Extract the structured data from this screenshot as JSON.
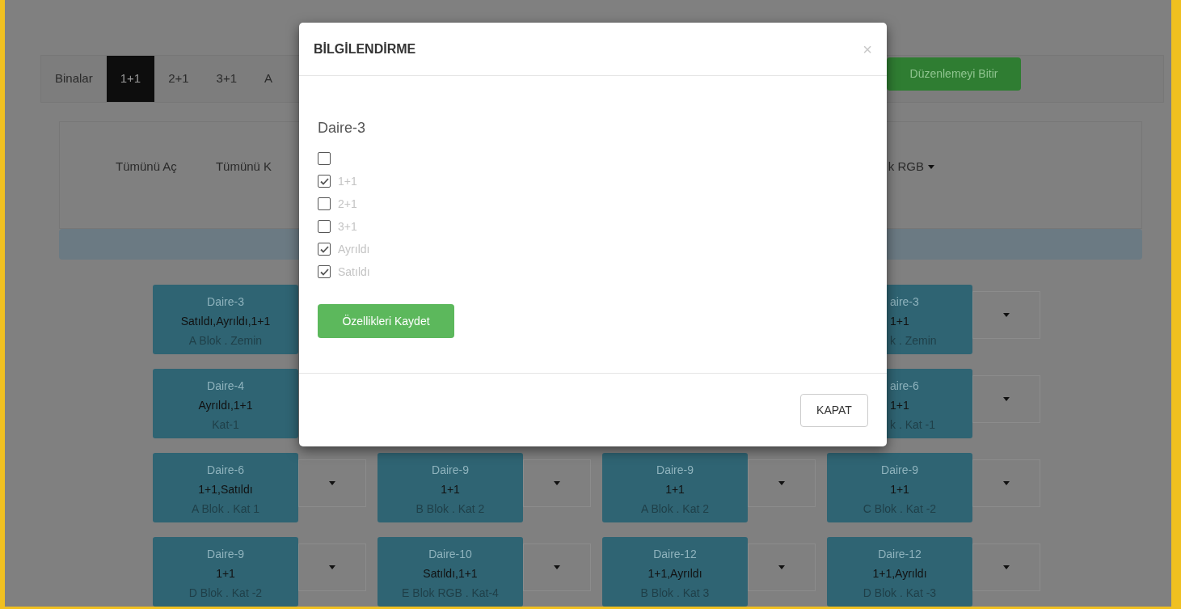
{
  "nav": {
    "items": [
      {
        "label": "Binalar",
        "selected": false
      },
      {
        "label": "1+1",
        "selected": true
      },
      {
        "label": "2+1",
        "selected": false
      },
      {
        "label": "3+1",
        "selected": false
      },
      {
        "label": "A",
        "selected": false
      }
    ],
    "finish_button": "Düzenlemeyi Bitir"
  },
  "panel": {
    "actions": [
      "Tümünü Aç",
      "Tümünü K"
    ],
    "dropdown": "k RGB"
  },
  "apartment_rows": [
    [
      {
        "kind": "full",
        "title": "Daire-3",
        "features": "Satıldı,Ayrıldı,1+1",
        "location": "A Blok . Zemin",
        "menu_button": false
      },
      {
        "kind": "covered"
      },
      {
        "kind": "covered"
      },
      {
        "kind": "clipped",
        "title": "aire-3",
        "features": "1+1",
        "location": "k . Zemin",
        "menu_button": true
      }
    ],
    [
      {
        "kind": "full",
        "title": "Daire-4",
        "features": "Ayrıldı,1+1",
        "location": "Kat-1",
        "menu_button": false
      },
      {
        "kind": "covered"
      },
      {
        "kind": "covered"
      },
      {
        "kind": "clipped",
        "title": "aire-6",
        "features": "1+1",
        "location": "k . Kat -1",
        "menu_button": true
      }
    ],
    [
      {
        "kind": "full",
        "title": "Daire-6",
        "features": "1+1,Satıldı",
        "location": "A Blok . Kat 1",
        "menu_button": true
      },
      {
        "kind": "full",
        "title": "Daire-9",
        "features": "1+1",
        "location": "B Blok . Kat 2",
        "menu_button": true
      },
      {
        "kind": "full",
        "title": "Daire-9",
        "features": "1+1",
        "location": "A Blok . Kat 2",
        "menu_button": true
      },
      {
        "kind": "full",
        "title": "Daire-9",
        "features": "1+1",
        "location": "C Blok . Kat -2",
        "menu_button": true
      }
    ],
    [
      {
        "kind": "full",
        "title": "Daire-9",
        "features": "1+1",
        "location": "D Blok . Kat -2",
        "menu_button": true
      },
      {
        "kind": "full",
        "title": "Daire-10",
        "features": "Satıldı,1+1",
        "location": "E Blok RGB . Kat-4",
        "menu_button": true
      },
      {
        "kind": "full",
        "title": "Daire-12",
        "features": "1+1,Ayrıldı",
        "location": "B Blok . Kat 3",
        "menu_button": true
      },
      {
        "kind": "full",
        "title": "Daire-12",
        "features": "1+1,Ayrıldı",
        "location": "D Blok . Kat -3",
        "menu_button": true
      }
    ]
  ],
  "modal": {
    "title": "BİLGİLENDİRME",
    "close": "×",
    "heading": "Daire-3",
    "options": [
      {
        "checked": false
      },
      {
        "label": "1+1",
        "checked": true
      },
      {
        "label": "2+1",
        "checked": false
      },
      {
        "label": "3+1",
        "checked": false
      },
      {
        "label": "Ayrıldı",
        "checked": true
      },
      {
        "label": "Satıldı",
        "checked": true
      }
    ],
    "save_button": "Özellikleri Kaydet",
    "close_button": "KAPAT"
  }
}
